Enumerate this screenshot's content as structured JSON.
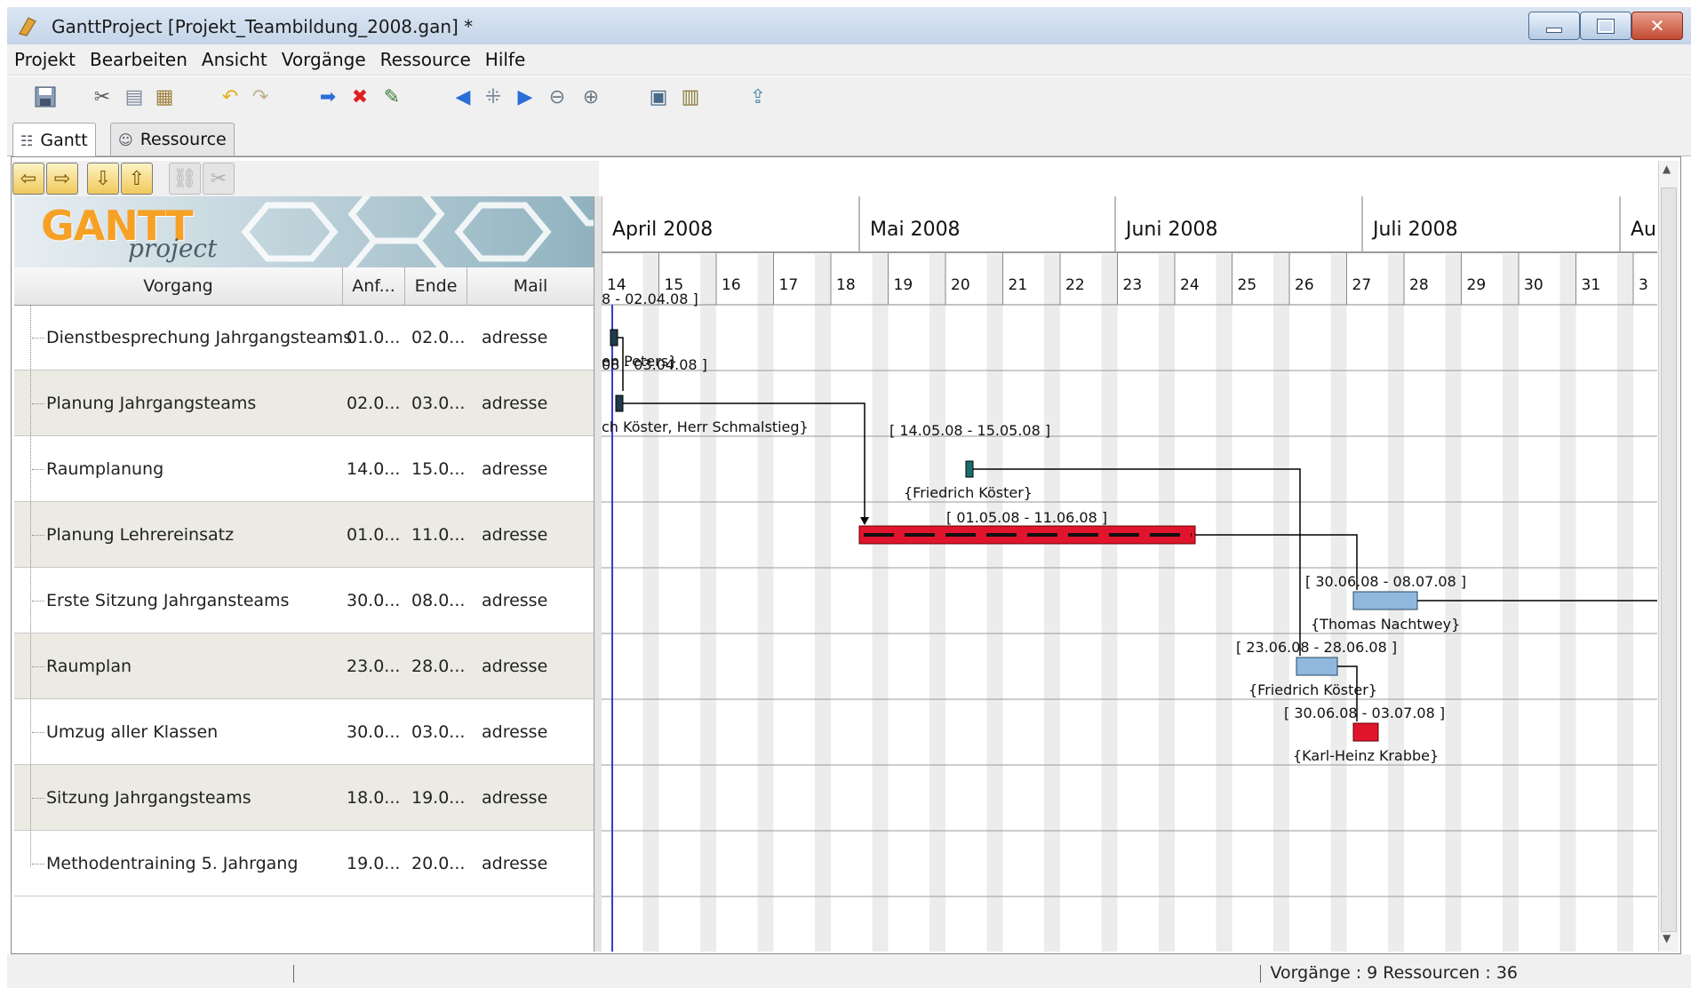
{
  "window": {
    "title": "GanttProject [Projekt_Teambildung_2008.gan] *",
    "controls": {
      "minimize": "minimize-icon",
      "restore": "restore-icon",
      "close": "close-icon"
    }
  },
  "menu": [
    "Projekt",
    "Bearbeiten",
    "Ansicht",
    "Vorgänge",
    "Ressource",
    "Hilfe"
  ],
  "toolbar": {
    "icons": [
      "save-icon",
      "cut-icon",
      "copy-icon",
      "paste-icon",
      "undo-icon",
      "redo-icon",
      "new-task-icon",
      "delete-icon",
      "properties-icon",
      "scroll-left-icon",
      "center-icon",
      "scroll-right-icon",
      "zoom-out-icon",
      "zoom-in-icon",
      "preview-icon",
      "export-icon",
      "publish-icon"
    ]
  },
  "tabs": [
    {
      "label": "Gantt",
      "active": true
    },
    {
      "label": "Ressource",
      "active": false
    }
  ],
  "logo": {
    "text": "GANTT",
    "sub": "project"
  },
  "table": {
    "columns": [
      "Vorgang",
      "Anf...",
      "Ende",
      "Mail"
    ],
    "rows": [
      {
        "name": "Dienstbesprechung Jahrgangsteams",
        "start": "01.0...",
        "end": "02.0...",
        "mail": "adresse"
      },
      {
        "name": "Planung Jahrgangsteams",
        "start": "02.0...",
        "end": "03.0...",
        "mail": "adresse"
      },
      {
        "name": "Raumplanung",
        "start": "14.0...",
        "end": "15.0...",
        "mail": "adresse"
      },
      {
        "name": "Planung Lehrereinsatz",
        "start": "01.0...",
        "end": "11.0...",
        "mail": "adresse"
      },
      {
        "name": "Erste Sitzung Jahrgansteams",
        "start": "30.0...",
        "end": "08.0...",
        "mail": "adresse"
      },
      {
        "name": "Raumplan",
        "start": "23.0...",
        "end": "28.0...",
        "mail": "adresse"
      },
      {
        "name": "Umzug aller Klassen",
        "start": "30.0...",
        "end": "03.0...",
        "mail": "adresse"
      },
      {
        "name": "Sitzung Jahrgangsteams",
        "start": "18.0...",
        "end": "19.0...",
        "mail": "adresse"
      },
      {
        "name": "Methodentraining 5. Jahrgang",
        "start": "19.0...",
        "end": "20.0...",
        "mail": "adresse"
      }
    ]
  },
  "timeline": {
    "months": [
      "April 2008",
      "Mai 2008",
      "Juni 2008",
      "Juli 2008",
      "Aug"
    ],
    "weeks": [
      "14",
      "15",
      "16",
      "17",
      "18",
      "19",
      "20",
      "21",
      "22",
      "23",
      "24",
      "25",
      "26",
      "27",
      "28",
      "29",
      "30",
      "31",
      "3"
    ]
  },
  "chart_labels": {
    "t1_dates": "8 - 02.04.08 ]",
    "t1_res": "en Peters}",
    "t2_dates": "08 - 03.04.08 ]",
    "t2_res": "ch Köster, Herr Schmalstieg}",
    "t3_dates": "[ 14.05.08 - 15.05.08 ]",
    "t3_res": "{Friedrich Köster}",
    "t4_dates": "[ 01.05.08 - 11.06.08 ]",
    "t5_dates": "[ 30.06.08 - 08.07.08 ]",
    "t5_res": "{Thomas Nachtwey}",
    "t6_dates": "[ 23.06.08 - 28.06.08 ]",
    "t6_res": "{Friedrich Köster}",
    "t7_dates": "[ 30.06.08 - 03.07.08 ]",
    "t7_res": "{Karl-Heinz Krabbe}"
  },
  "colors": {
    "critical_bar": "#e0152d",
    "task_bar": "#8fb8dc",
    "milestone_task": "#1e3b4a",
    "today_line": "#3a3ad0"
  },
  "status": {
    "text": "Vorgänge : 9  Ressourcen : 36"
  }
}
